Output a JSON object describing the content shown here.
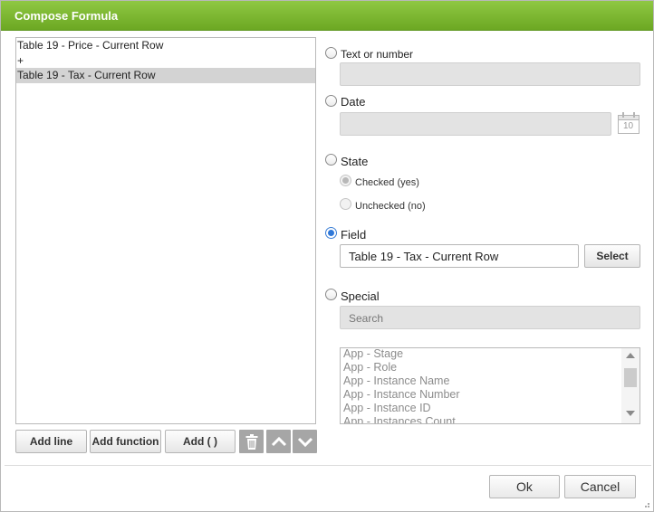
{
  "dialog": {
    "title": "Compose Formula"
  },
  "formula": {
    "lines": [
      {
        "text": "Table 19 - Price - Current Row",
        "selected": false
      },
      {
        "text": "+",
        "selected": false
      },
      {
        "text": "Table 19 - Tax - Current Row",
        "selected": true
      }
    ]
  },
  "left_buttons": {
    "add_line": "Add line",
    "add_function": "Add function",
    "add_parens": "Add ( )",
    "icons": [
      "trash-icon",
      "chevron-up-icon",
      "chevron-down-icon"
    ]
  },
  "options": {
    "text_or_number": {
      "label": "Text or number",
      "value": ""
    },
    "date": {
      "label": "Date",
      "value": "",
      "calendar_day": "10"
    },
    "state": {
      "label": "State",
      "checked_label": "Checked (yes)",
      "unchecked_label": "Unchecked (no)"
    },
    "field": {
      "label": "Field",
      "value": "Table 19 - Tax - Current Row",
      "select_label": "Select"
    },
    "special": {
      "label": "Special",
      "search_placeholder": "Search",
      "items": [
        "App - Stage",
        "App - Role",
        "App - Instance Name",
        "App - Instance Number",
        "App - Instance ID",
        "App - Instances Count"
      ]
    },
    "selected": "field"
  },
  "footer": {
    "ok": "Ok",
    "cancel": "Cancel"
  },
  "colors": {
    "titlebar": "#7ab532",
    "radio_selected": "#2f78d8",
    "icon_button": "#a6a6a6"
  }
}
